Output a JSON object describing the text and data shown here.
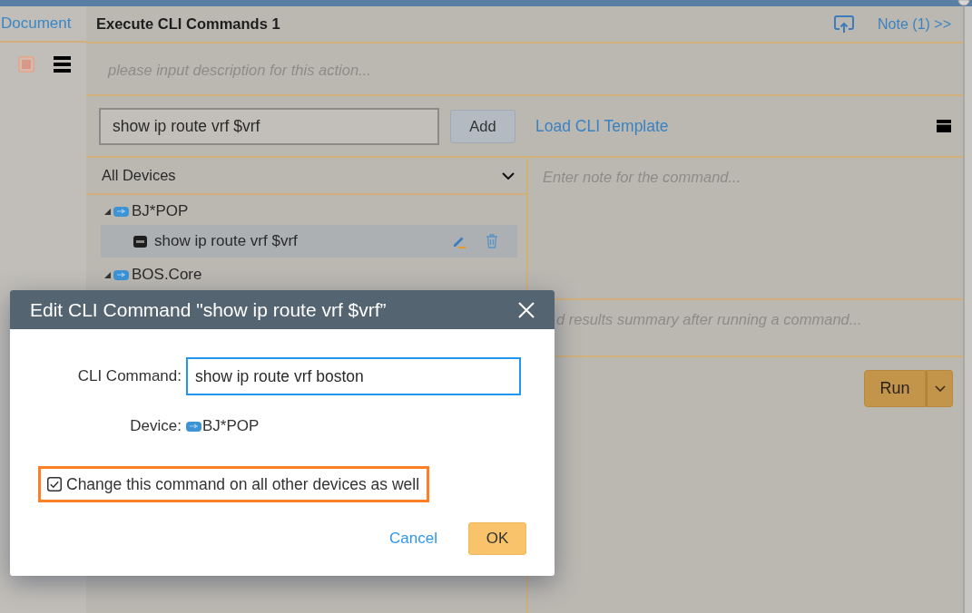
{
  "sidebar": {
    "tab": "Document"
  },
  "panel": {
    "title": "Execute CLI Commands 1",
    "note_link": "Note (1) >>",
    "description": {
      "placeholder": "please input description for this action..."
    }
  },
  "command_bar": {
    "input": {
      "value": "show ip route vrf $vrf"
    },
    "add_button": "Add",
    "template_link": "Load CLI Template"
  },
  "devices": {
    "filter": "All Devices",
    "tree": [
      {
        "kind": "device",
        "label": "BJ*POP",
        "expanded": true,
        "selected": false,
        "children": [
          {
            "kind": "command",
            "label": "show ip route vrf $vrf",
            "selected": true
          }
        ]
      },
      {
        "kind": "device",
        "label": "BOS.Core",
        "expanded": true,
        "selected": false
      }
    ]
  },
  "note": {
    "placeholder": "Enter note for the command..."
  },
  "summary": {
    "placeholder": "d results summary after running a command..."
  },
  "run_button": {
    "label": "Run"
  },
  "dialog": {
    "title": "Edit CLI Command \"show ip route vrf $vrf”",
    "command": {
      "label": "CLI Command:",
      "value": "show ip route vrf boston",
      "focused": true
    },
    "device": {
      "label": "Device:",
      "value": "BJ*POP"
    },
    "option": {
      "label": "Change this command on all other devices as well",
      "checked": true,
      "highlighted": true
    },
    "buttons": [
      {
        "kind": "link",
        "label": "Cancel"
      },
      {
        "kind": "primary",
        "label": "OK"
      }
    ]
  }
}
